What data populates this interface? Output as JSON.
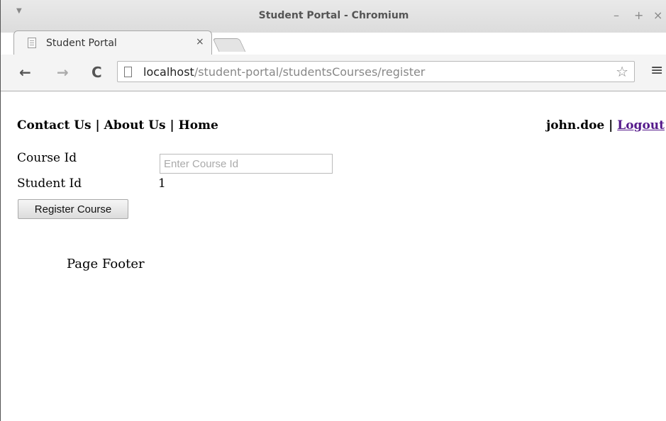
{
  "window": {
    "title": "Student Portal - Chromium",
    "controls": {
      "minimize": "–",
      "maximize": "+",
      "close": "×"
    }
  },
  "tabs": [
    {
      "label": "Student Portal",
      "close": "×",
      "active": true
    }
  ],
  "toolbar": {
    "back": "←",
    "forward": "→",
    "reload": "C",
    "url_host": "localhost",
    "url_path": "/student-portal/studentsCourses/register",
    "menu": "≡"
  },
  "page": {
    "nav": {
      "contact": "Contact Us",
      "about": "About Us",
      "home": "Home",
      "sep": "|"
    },
    "user": {
      "name": "john.doe",
      "sep": "|",
      "logout": "Logout"
    },
    "form": {
      "course_label": "Course Id",
      "course_placeholder": "Enter Course Id",
      "course_value": "",
      "student_label": "Student Id",
      "student_value": "1",
      "submit_label": "Register Course"
    },
    "footer": "Page Footer"
  },
  "colors": {
    "link_visited": "#551a8b",
    "chrome_bg": "#f4f4f4"
  }
}
